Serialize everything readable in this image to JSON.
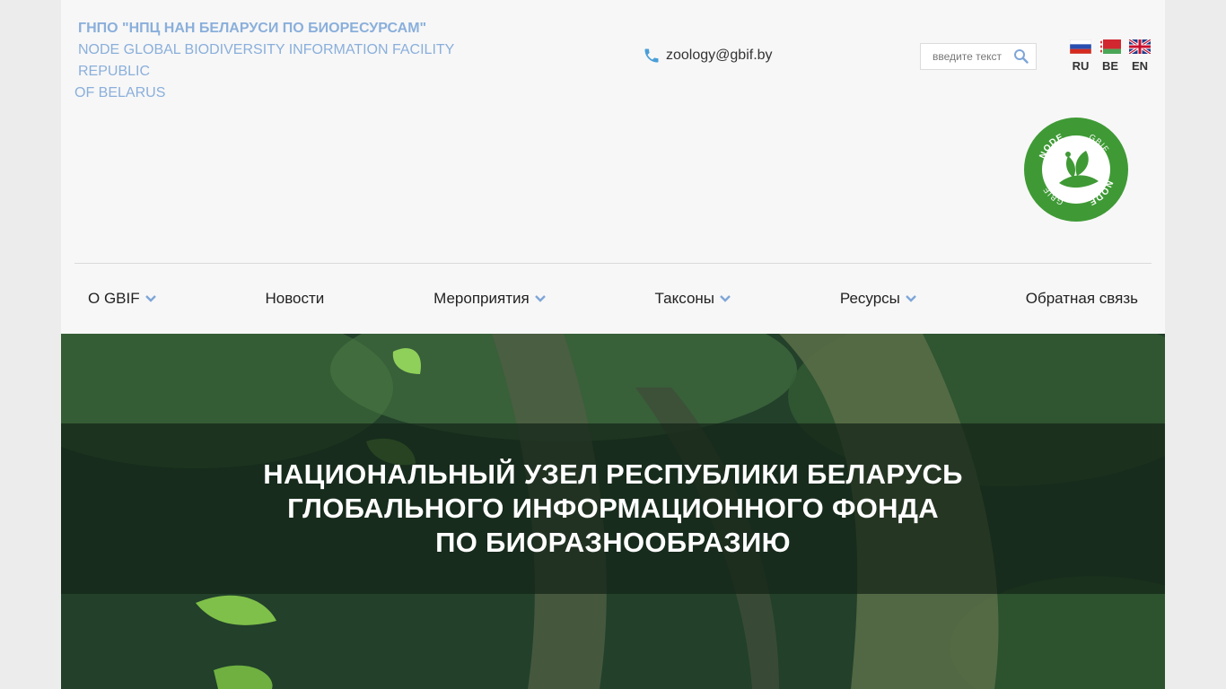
{
  "header": {
    "org_ru": "ГНПО \"НПЦ НАН БЕЛАРУСИ ПО БИОРЕСУРСАМ\"",
    "org_en_line1": "NODE GLOBAL BIODIVERSITY INFORMATION FACILITY REPUBLIC",
    "org_en_line2": "OF BELARUS",
    "email": "zoology@gbif.by",
    "search_placeholder": "введите текст",
    "icons": {
      "phone": "phone-icon",
      "search": "search-icon"
    },
    "languages": [
      {
        "code": "RU",
        "flag": "russia-flag-icon"
      },
      {
        "code": "BE",
        "flag": "belarus-flag-icon"
      },
      {
        "code": "EN",
        "flag": "uk-flag-icon"
      }
    ]
  },
  "logo": {
    "top_text": "NODE",
    "right_text": "GBIF",
    "bottom_text": "NODE",
    "left_text": "GBIF"
  },
  "nav": {
    "items": [
      {
        "label": "О GBIF",
        "has_dropdown": true
      },
      {
        "label": "Новости",
        "has_dropdown": false
      },
      {
        "label": "Мероприятия",
        "has_dropdown": true
      },
      {
        "label": "Таксоны",
        "has_dropdown": true
      },
      {
        "label": "Ресурсы",
        "has_dropdown": true
      },
      {
        "label": "Обратная связь",
        "has_dropdown": false
      }
    ]
  },
  "hero": {
    "line1": "НАЦИОНАЛЬНЫЙ УЗЕЛ РЕСПУБЛИКИ БЕЛАРУСЬ",
    "line2": "ГЛОБАЛЬНОГО ИНФОРМАЦИОННОГО ФОНДА",
    "line3": "ПО БИОРАЗНООБРАЗИЮ"
  },
  "colors": {
    "accent_blue": "#8aafdb",
    "chevron_blue": "#7ea6d8",
    "logo_green": "#3f9a35",
    "phone_blue": "#4a9fd8"
  }
}
